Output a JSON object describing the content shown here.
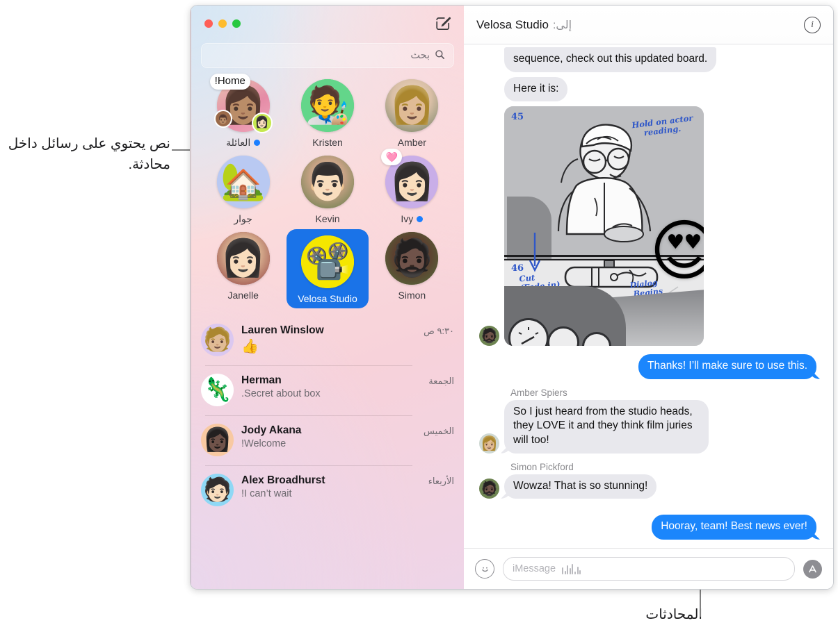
{
  "annotations": {
    "left_callout": "نص يحتوي على رسائل داخل محادثة.",
    "bottom_callout": "المحادثات"
  },
  "window": {
    "traffic_lights": [
      "green-button",
      "yellow-button",
      "close-button"
    ]
  },
  "sidebar": {
    "compose_icon": "compose-icon",
    "search": {
      "placeholder": "بحث",
      "icon": "search-icon"
    },
    "pinned": [
      {
        "name": "Amber",
        "avatar": "photo-woman-glasses",
        "emoji": "👩🏼",
        "bg": "#cfd9d4",
        "unread": false,
        "badge": null,
        "tapback": null
      },
      {
        "name": "Kristen",
        "avatar": "memoji-beanie",
        "emoji": "🧑‍🎨",
        "bg": "#63d68a",
        "unread": false,
        "badge": null,
        "tapback": null
      },
      {
        "name": "العائلة",
        "avatar": "photo-family-group",
        "emoji": "👩🏽",
        "bg": "#e8a9b8",
        "unread": true,
        "badge": "Home!",
        "tapback": null
      },
      {
        "name": "Ivy",
        "avatar": "memoji-red-hat",
        "emoji": "👩🏻",
        "bg": "#c9aee8",
        "unread": true,
        "badge": null,
        "tapback": "🩷"
      },
      {
        "name": "Kevin",
        "avatar": "photo-man-glasses",
        "emoji": "👨🏻",
        "bg": "#7e8f63",
        "unread": false,
        "badge": null,
        "tapback": null
      },
      {
        "name": "جوار",
        "avatar": "emoji-house",
        "emoji": "🏡",
        "bg": "#b9c9f2",
        "unread": false,
        "badge": null,
        "tapback": null
      },
      {
        "name": "Simon",
        "avatar": "photo-man-sunglasses",
        "emoji": "🧔🏿",
        "bg": "#6e8452",
        "unread": false,
        "badge": null,
        "tapback": null
      },
      {
        "name": "Velosa Studio",
        "avatar": "emoji-film-projector",
        "emoji": "📽️",
        "bg": "#f5e600",
        "unread": false,
        "badge": null,
        "tapback": null,
        "selected": true,
        "selected_bg": "#1a73e8"
      },
      {
        "name": "Janelle",
        "avatar": "photo-woman-bob",
        "emoji": "👩🏻",
        "bg": "#8f3b3b",
        "unread": false,
        "badge": null,
        "tapback": null
      }
    ],
    "conversations": [
      {
        "name": "Lauren Winslow",
        "preview": "👍",
        "preview_is_emoji": true,
        "time": "٩:٣٠ ص",
        "avatar": "memoji-blonde-buns",
        "emoji": "🧑🏼",
        "bg": "#dbc8f0"
      },
      {
        "name": "Herman",
        "preview": "Secret about box.",
        "preview_is_emoji": false,
        "time": "الجمعة",
        "avatar": "photo-iguana",
        "emoji": "🦎",
        "bg": "#ffffff"
      },
      {
        "name": "Jody Akana",
        "preview": "Welcome!",
        "preview_is_emoji": false,
        "time": "الخميس",
        "avatar": "memoji-long-hair",
        "emoji": "👩🏿",
        "bg": "#f8c9a2"
      },
      {
        "name": "Alex Broadhurst",
        "preview": "I can’t wait!",
        "preview_is_emoji": false,
        "time": "الأربعاء",
        "avatar": "memoji-glasses",
        "emoji": "🧑🏻",
        "bg": "#8fd8f5"
      }
    ]
  },
  "conversation": {
    "to_label": "إلى:",
    "to_value": "Velosa Studio",
    "info_icon": "info-icon",
    "messages": [
      {
        "kind": "in",
        "sender": null,
        "text": "sequence, check out this updated board.",
        "clipped": true
      },
      {
        "kind": "in",
        "sender": null,
        "text": "Here it is:"
      },
      {
        "kind": "attachment",
        "sender": null,
        "attachment": "storyboard-image",
        "sketch": {
          "frame_top_number": "45",
          "frame_bottom_number": "46",
          "note_top": "Hold on actor\n    reading.",
          "note_cut": "Cut\n(Fade in)",
          "note_dialog": "Dialog\n Begins\n  Here"
        },
        "reaction_emoji": "😍"
      },
      {
        "kind": "out",
        "sender": null,
        "text": "Thanks! I’ll make sure to use this."
      },
      {
        "kind": "in",
        "sender": "Amber Spiers",
        "text": "So I just heard from the studio heads, they LOVE it and they think film juries will too!"
      },
      {
        "kind": "in",
        "sender": "Simon Pickford",
        "text": "Wowza! That is so stunning!"
      },
      {
        "kind": "out",
        "sender": null,
        "text": "Hooray, team! Best news ever!"
      }
    ],
    "composer": {
      "apps_icon": "app-store-icon",
      "emoji_icon": "emoji-smiley-icon",
      "audio_icon": "audio-waveform-icon",
      "placeholder": "iMessage"
    }
  },
  "colors": {
    "bubble_out": "#1b86fc",
    "bubble_in": "#e8e8ed",
    "selected_pin": "#1a73e8",
    "unread_dot": "#1b7fff"
  }
}
